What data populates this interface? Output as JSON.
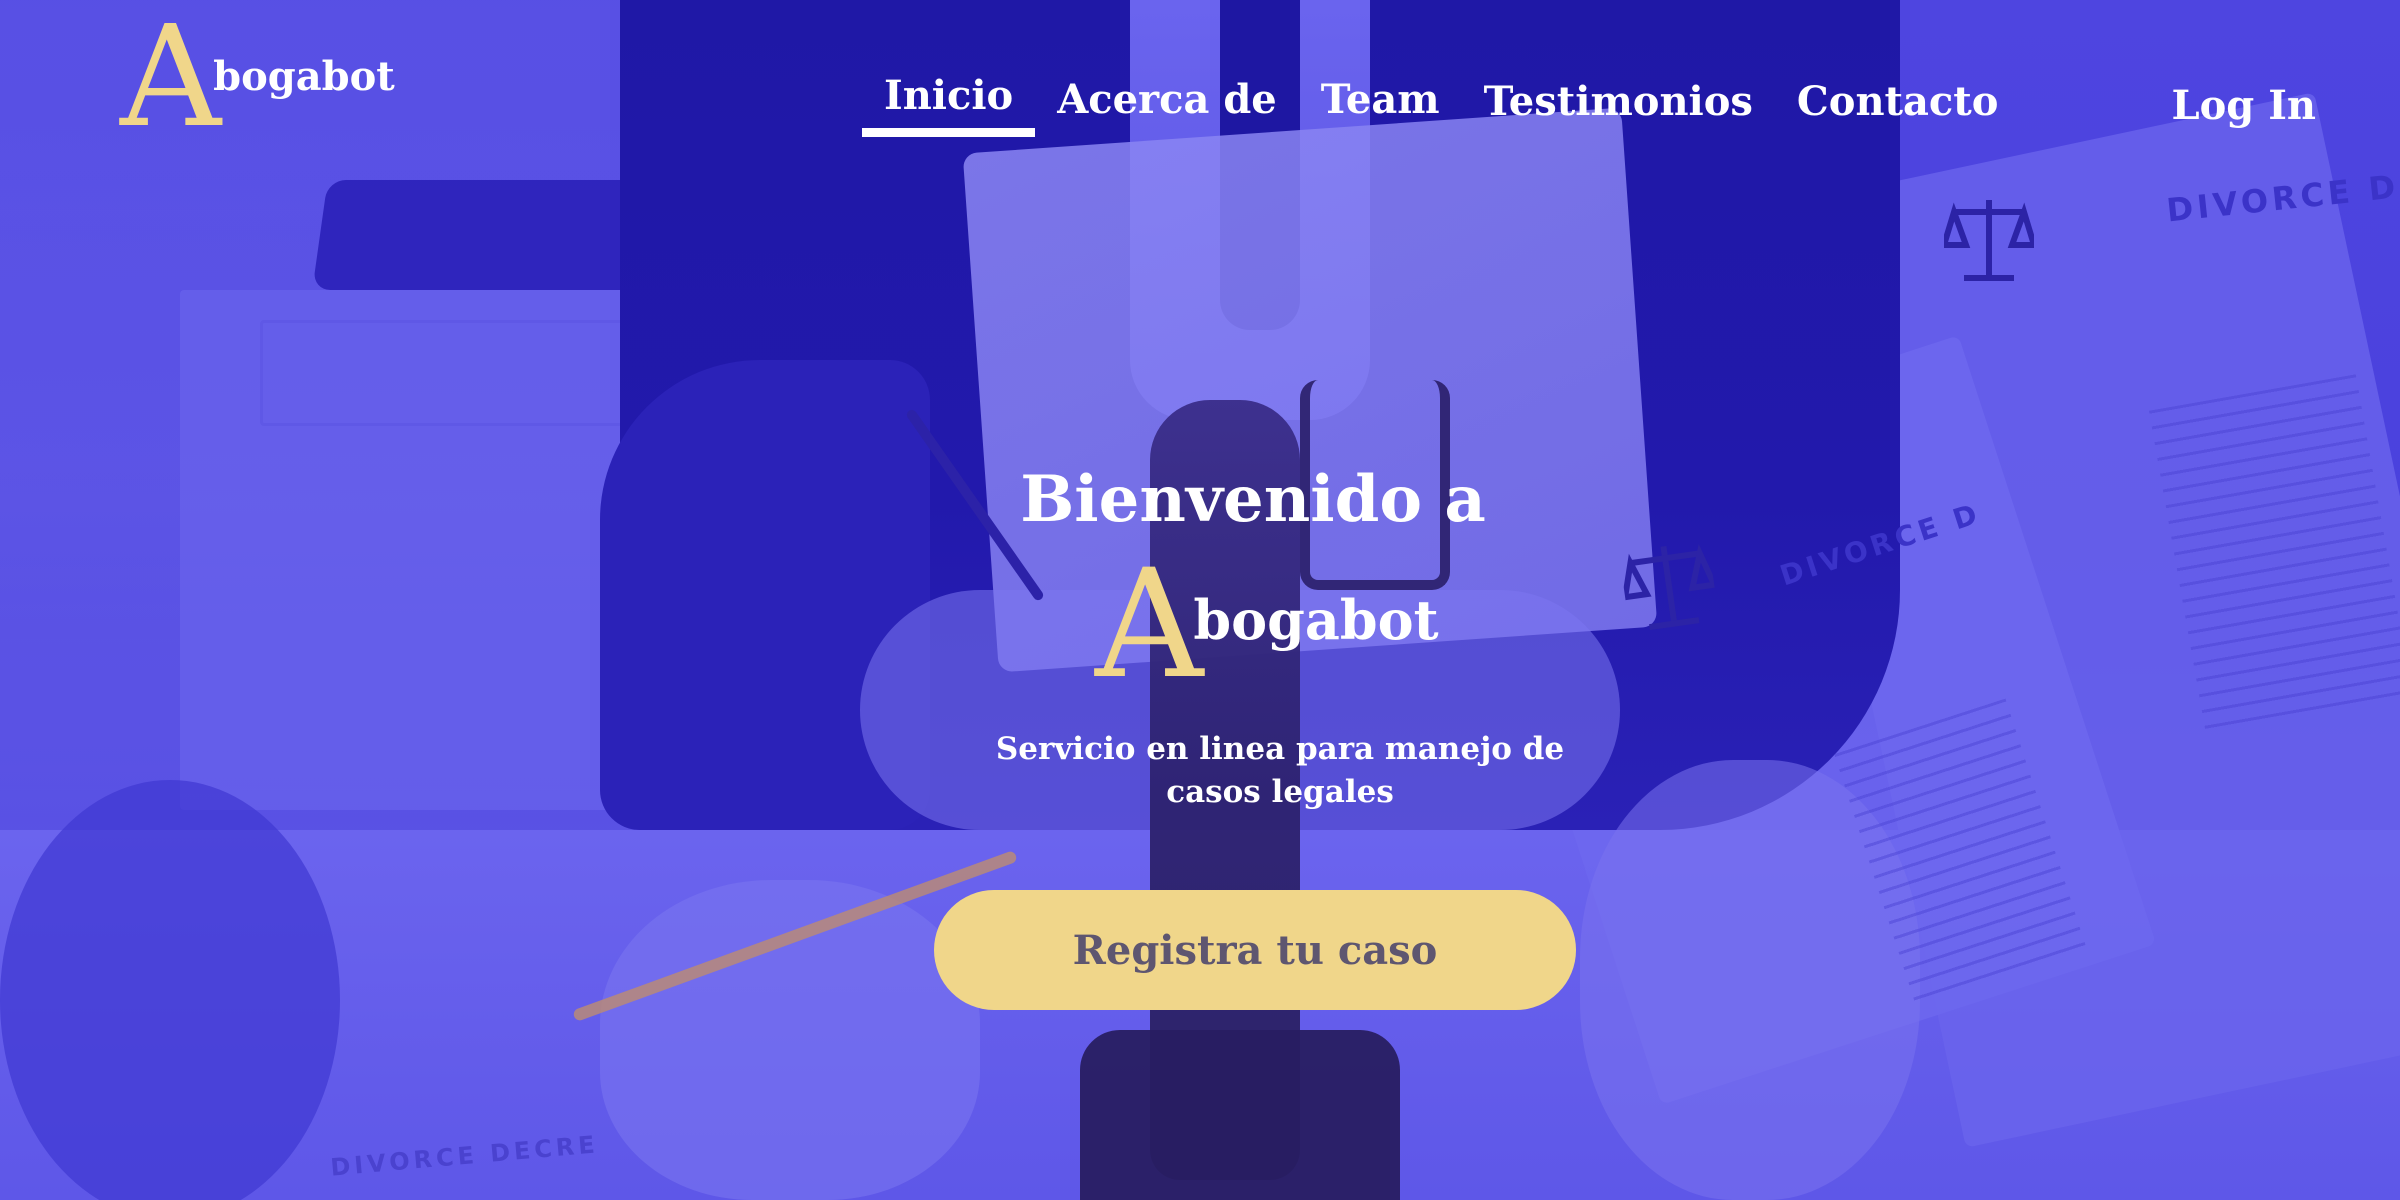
{
  "brand": {
    "initial": "A",
    "rest": "bogabot",
    "accent_color": "#f0d68a"
  },
  "nav": {
    "items": [
      {
        "label": "Inicio",
        "active": true
      },
      {
        "label": "Acerca de",
        "active": false
      },
      {
        "label": "Team",
        "active": false
      },
      {
        "label": "Testimonios",
        "active": false
      },
      {
        "label": "Contacto",
        "active": false
      }
    ],
    "login_label": "Log In"
  },
  "hero": {
    "title": "Bienvenido a",
    "logo_initial": "A",
    "logo_rest": "bogabot",
    "subtitle": "Servicio en linea para manejo de casos legales",
    "cta_label": "Registra tu caso",
    "overlay_color": "#4a40dc"
  },
  "background": {
    "doc_heading": "DIVORCE DE",
    "doc_heading_mid": "DIVORCE D",
    "doc_heading_bottom": "DIVORCE DECRE"
  }
}
